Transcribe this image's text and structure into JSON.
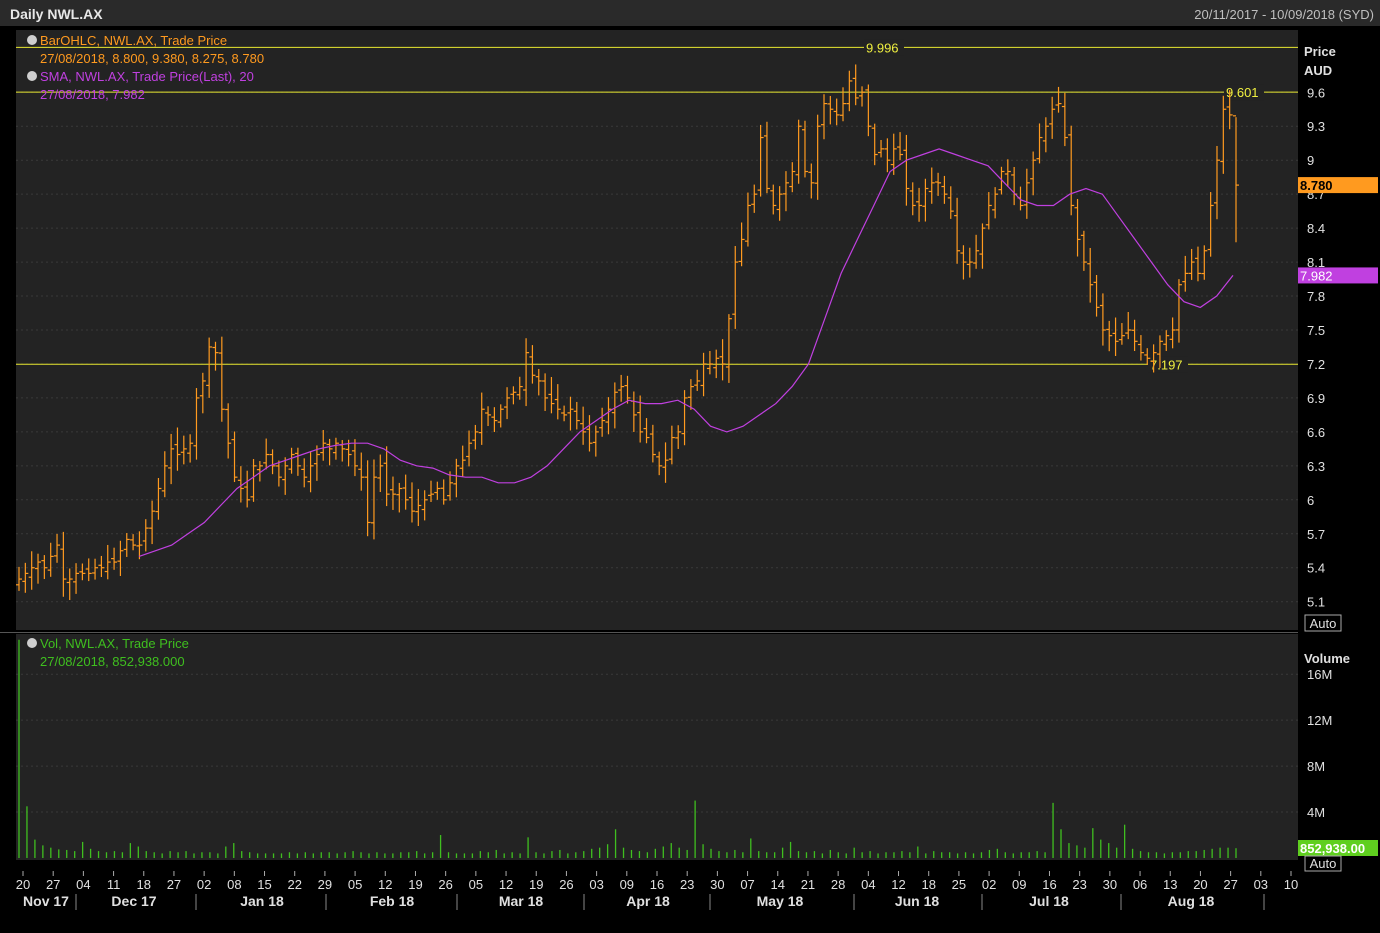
{
  "window": {
    "title": "Daily NWL.AX",
    "date_range": "20/11/2017 - 10/09/2018 (SYD)"
  },
  "legend": {
    "ohlc_title": "BarOHLC, NWL.AX, Trade Price",
    "ohlc_values": "27/08/2018, 8.800, 9.380, 8.275, 8.780",
    "sma_title": "SMA, NWL.AX, Trade Price(Last),  20",
    "sma_values": "27/08/2018, 7.982",
    "vol_title": "Vol, NWL.AX, Trade Price",
    "vol_values": "27/08/2018, 852,938.000"
  },
  "price_axis": {
    "title_line1": "Price",
    "title_line2": "AUD",
    "auto_label": "Auto",
    "ticks": [
      "5.1",
      "5.4",
      "5.7",
      "6",
      "6.3",
      "6.6",
      "6.9",
      "7.2",
      "7.5",
      "7.8",
      "8.1",
      "8.4",
      "8.7",
      "9",
      "9.3",
      "9.6"
    ],
    "last_price_tag": "8.780",
    "sma_tag": "7.982"
  },
  "volume_axis": {
    "title": "Volume",
    "auto_label": "Auto",
    "ticks": [
      "4M",
      "8M",
      "12M",
      "16M"
    ],
    "last_tag": "852,938.00"
  },
  "x_axis": {
    "day_labels": [
      "20",
      "27",
      "04",
      "11",
      "18",
      "27",
      "02",
      "08",
      "15",
      "22",
      "29",
      "05",
      "12",
      "19",
      "26",
      "05",
      "12",
      "19",
      "26",
      "03",
      "09",
      "16",
      "23",
      "30",
      "07",
      "14",
      "21",
      "28",
      "04",
      "12",
      "18",
      "25",
      "02",
      "09",
      "16",
      "23",
      "30",
      "06",
      "13",
      "20",
      "27",
      "03",
      "10"
    ],
    "month_labels": [
      "Nov 17",
      "Dec 17",
      "Jan 18",
      "Feb 18",
      "Mar 18",
      "Apr 18",
      "May 18",
      "Jun 18",
      "Jul 18",
      "Aug 18"
    ]
  },
  "chart_data": {
    "type": "bar",
    "subtype": "ohlc",
    "x_start": "20/11/2017",
    "x_end": "10/09/2018",
    "ylim": [
      4.85,
      10.15
    ],
    "horizontal_lines": [
      {
        "value": 9.996,
        "label": "9.996"
      },
      {
        "value": 9.601,
        "label": "9.601"
      },
      {
        "value": 7.197,
        "label": "7.197"
      }
    ],
    "ohlc_close_approx": [
      5.3,
      5.35,
      5.4,
      5.45,
      5.4,
      5.5,
      5.6,
      5.3,
      5.3,
      5.35,
      5.35,
      5.35,
      5.4,
      5.4,
      5.45,
      5.45,
      5.55,
      5.65,
      5.6,
      5.6,
      5.75,
      5.9,
      6.1,
      6.3,
      6.45,
      6.4,
      6.45,
      6.5,
      6.9,
      7.05,
      7.35,
      7.3,
      6.8,
      6.5,
      6.2,
      6.1,
      6.0,
      6.3,
      6.3,
      6.4,
      6.3,
      6.2,
      6.3,
      6.4,
      6.3,
      6.2,
      6.3,
      6.4,
      6.5,
      6.45,
      6.5,
      6.45,
      6.4,
      6.3,
      6.2,
      5.8,
      6.2,
      6.3,
      6.05,
      6.05,
      6.1,
      6.0,
      5.9,
      5.95,
      6.0,
      6.05,
      6.1,
      6.0,
      6.15,
      6.3,
      6.35,
      6.5,
      6.6,
      6.8,
      6.75,
      6.7,
      6.8,
      6.9,
      6.95,
      7.0,
      7.3,
      7.1,
      7.05,
      6.9,
      6.85,
      6.8,
      6.75,
      6.8,
      6.7,
      6.6,
      6.5,
      6.6,
      6.7,
      6.8,
      6.95,
      7.0,
      6.9,
      6.75,
      6.6,
      6.55,
      6.4,
      6.3,
      6.35,
      6.55,
      6.6,
      6.9,
      7.0,
      7.05,
      7.2,
      7.2,
      7.25,
      7.2,
      7.6,
      8.1,
      8.3,
      8.6,
      8.7,
      9.2,
      8.75,
      8.6,
      8.7,
      8.8,
      8.9,
      9.3,
      8.9,
      8.8,
      9.3,
      9.5,
      9.45,
      9.4,
      9.5,
      9.7,
      9.55,
      9.6,
      9.3,
      9.05,
      9.1,
      9.0,
      9.1,
      9.05,
      8.75,
      8.6,
      8.6,
      8.75,
      8.8,
      8.8,
      8.7,
      8.55,
      8.2,
      8.1,
      8.1,
      8.2,
      8.4,
      8.6,
      8.7,
      8.9,
      8.9,
      8.7,
      8.6,
      8.8,
      9.0,
      9.2,
      9.3,
      9.45,
      9.5,
      9.2,
      8.6,
      8.3,
      8.1,
      7.9,
      7.7,
      7.5,
      7.45,
      7.4,
      7.45,
      7.5,
      7.4,
      7.3,
      7.25,
      7.3,
      7.4,
      7.45,
      7.5,
      7.9,
      8.0,
      8.1,
      8.0,
      8.2,
      8.6,
      9.0,
      9.45,
      9.4,
      8.78
    ],
    "series": [
      {
        "name": "SMA, NWL.AX, Trade Price(Last),  20",
        "values": [
          5.5,
          5.55,
          5.6,
          5.7,
          5.8,
          5.95,
          6.1,
          6.2,
          6.3,
          6.35,
          6.4,
          6.45,
          6.48,
          6.5,
          6.5,
          6.45,
          6.35,
          6.3,
          6.28,
          6.22,
          6.2,
          6.2,
          6.15,
          6.15,
          6.2,
          6.3,
          6.45,
          6.6,
          6.7,
          6.8,
          6.88,
          6.85,
          6.85,
          6.88,
          6.8,
          6.65,
          6.6,
          6.65,
          6.75,
          6.85,
          7.0,
          7.2,
          7.6,
          8.0,
          8.3,
          8.6,
          8.9,
          9.0,
          9.05,
          9.1,
          9.05,
          9.0,
          8.95,
          8.8,
          8.65,
          8.6,
          8.6,
          8.7,
          8.75,
          8.7,
          8.5,
          8.3,
          8.1,
          7.9,
          7.75,
          7.7,
          7.8,
          7.982
        ]
      },
      {
        "name": "Vol, NWL.AX, Trade Price",
        "last_value": 852938
      }
    ],
    "volume_ylim": [
      0,
      19500000
    ],
    "volume_values_approx": [
      19000000,
      4500000,
      1600000,
      1100000,
      900000,
      750000,
      700000,
      600000,
      1400000,
      800000,
      600000,
      500000,
      600000,
      500000,
      1300000,
      1000000,
      600000,
      500000,
      400000,
      600000,
      500000,
      600000,
      400000,
      500000,
      500000,
      400000,
      1000000,
      1300000,
      600000,
      500000,
      400000,
      400000,
      400000,
      400000,
      500000,
      400000,
      500000,
      400000,
      500000,
      500000,
      400000,
      500000,
      600000,
      500000,
      400000,
      500000,
      400000,
      400000,
      500000,
      500000,
      600000,
      400000,
      500000,
      2000000,
      500000,
      400000,
      400000,
      400000,
      600000,
      500000,
      700000,
      400000,
      500000,
      400000,
      1800000,
      500000,
      400000,
      600000,
      700000,
      400000,
      500000,
      600000,
      800000,
      900000,
      1200000,
      2500000,
      900000,
      700000,
      600000,
      500000,
      800000,
      1000000,
      1300000,
      900000,
      700000,
      5000000,
      1200000,
      800000,
      600000,
      500000,
      700000,
      500000,
      1700000,
      600000,
      500000,
      500000,
      900000,
      1400000,
      600000,
      500000,
      600000,
      400000,
      700000,
      500000,
      400000,
      900000,
      500000,
      600000,
      400000,
      500000,
      500000,
      600000,
      500000,
      1000000,
      400000,
      600000,
      500000,
      500000,
      400000,
      500000,
      400000,
      500000,
      700000,
      800000,
      500000,
      400000,
      500000,
      500000,
      600000,
      500000,
      4800000,
      2500000,
      1300000,
      1100000,
      900000,
      2600000,
      1600000,
      1300000,
      900000,
      2900000,
      800000,
      600000,
      500000,
      500000,
      400000,
      500000,
      500000,
      600000,
      600000,
      700000,
      800000,
      900000,
      900000,
      852938
    ]
  }
}
